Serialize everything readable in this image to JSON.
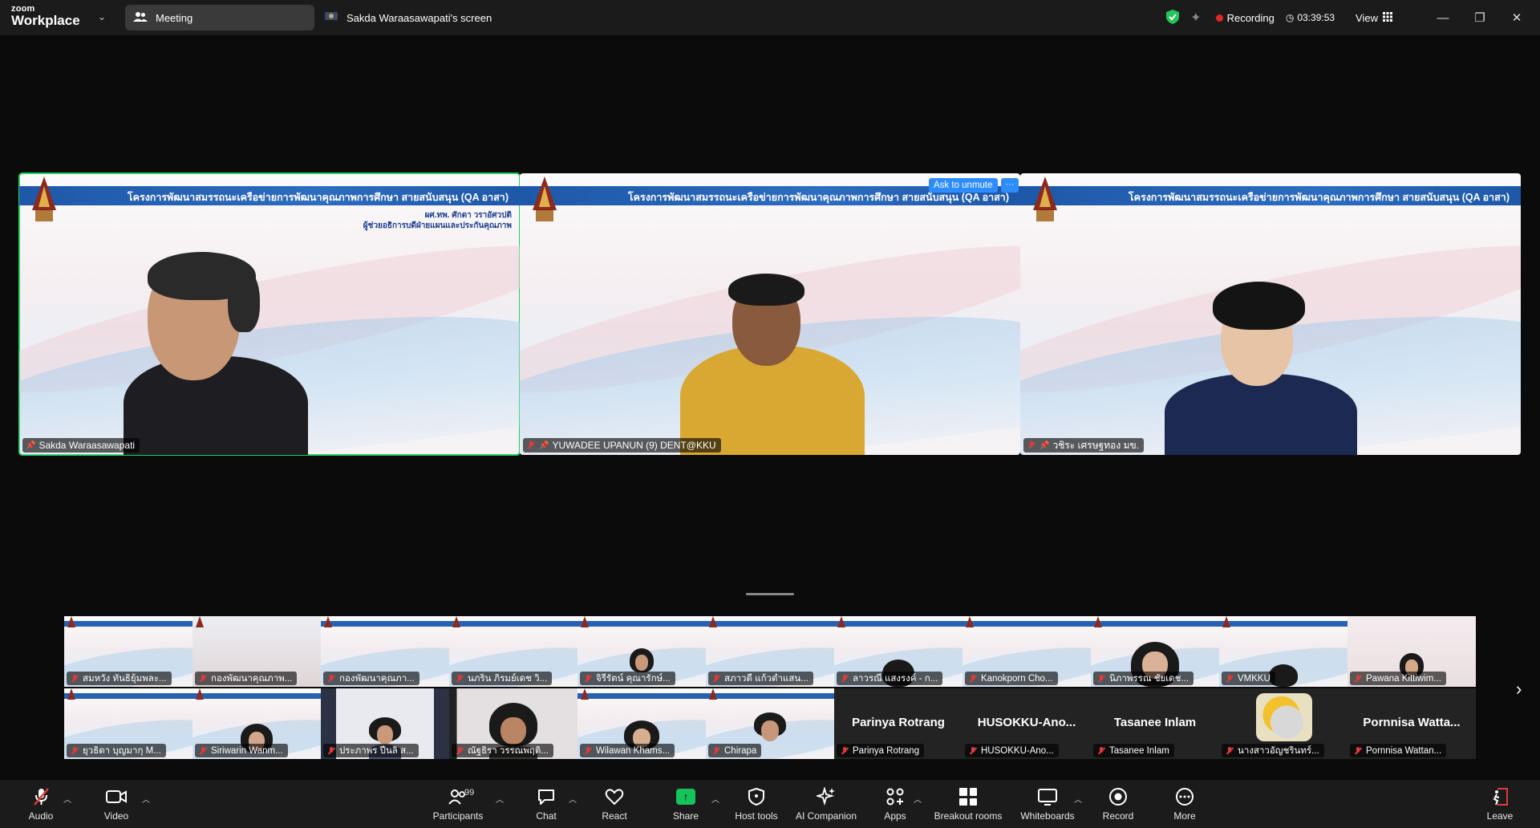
{
  "titlebar": {
    "brand_top": "zoom",
    "brand_bottom": "Workplace",
    "meeting_tab": "Meeting",
    "screen_tab": "Sakda Waraasawapati's screen",
    "recording_label": "Recording",
    "timer": "03:39:53",
    "view_label": "View"
  },
  "slide": {
    "banner_title": "โครงการพัฒนาสมรรถนะเครือข่ายการพัฒนาคุณภาพการศึกษา สายสนับสนุน (QA อาสา)",
    "presenter_name": "ผศ.ทพ. ศักดา วราอัศวปติ",
    "presenter_role": "ผู้ช่วยอธิการบดีฝ่ายแผนและประกันคุณภาพ"
  },
  "main_tiles": [
    {
      "name": "Sakda Waraasawapati"
    },
    {
      "name": "YUWADEE UPANUN (9) DENT@KKU"
    },
    {
      "name": "วชิระ เศรษฐทอง มข."
    }
  ],
  "ask_to_unmute": "Ask to unmute",
  "more_dots": "···",
  "thumbnails_row1": [
    {
      "name": "สมหวัง ทันธิยุ้มพละ..."
    },
    {
      "name": "กองพัฒนาคุณภาพ..."
    },
    {
      "name": "กองพัฒนาคุณภา..."
    },
    {
      "name": "นภริน ภิรมย์เดช วิ..."
    },
    {
      "name": "จิรีรัตน์ คุณารักษ์..."
    },
    {
      "name": "สภาวดี แก้วดำแสน..."
    },
    {
      "name": "ลาวรณี แสงรงค์ - ก..."
    },
    {
      "name": "Kanokporn Cho..."
    },
    {
      "name": "นิภาพรรณ ชัยเดช..."
    },
    {
      "name": "VMKKU"
    },
    {
      "name": "Pawana Kittiwim..."
    }
  ],
  "thumbnails_row2": [
    {
      "name": "ยุวธิดา บุญมากุ M..."
    },
    {
      "name": "Siriwarin Wanm..."
    },
    {
      "name": "ประภาพร ปีนลิ ส..."
    },
    {
      "name": "ณัฐธิรา วรรณพฤติ..."
    },
    {
      "name": "Wilawan Khams..."
    },
    {
      "name": "Chirapa"
    },
    {
      "name": "Parinya Rotrang",
      "big": "Parinya Rotrang"
    },
    {
      "name": "HUSOKKU-Ano...",
      "big": "HUSOKKU-Ano..."
    },
    {
      "name": "Tasanee Inlam",
      "big": "Tasanee Inlam"
    },
    {
      "name": "นางสาวอัญชรินทร์..."
    },
    {
      "name": "Pornnisa Wattan...",
      "big": "Pornnisa  Watta..."
    }
  ],
  "toolbar": {
    "audio": "Audio",
    "video": "Video",
    "participants": "Participants",
    "participants_count": "99",
    "chat": "Chat",
    "react": "React",
    "share": "Share",
    "host_tools": "Host tools",
    "ai_companion": "AI Companion",
    "apps": "Apps",
    "breakout_rooms": "Breakout rooms",
    "whiteboards": "Whiteboards",
    "record": "Record",
    "more": "More",
    "leave": "Leave"
  },
  "colors": {
    "active_speaker": "#23d160",
    "recording": "#e02828",
    "share_green": "#16c35a",
    "banner_blue": "#2961b1",
    "toolbar_bg": "#1b1b1b"
  },
  "icons": [
    "shield-check-icon",
    "sparkle-icon",
    "clock-icon",
    "grid-view-icon",
    "minimize-icon",
    "restore-icon",
    "close-icon",
    "mic-off-icon",
    "video-icon",
    "participants-icon",
    "chat-icon",
    "heart-icon",
    "share-arrow-icon",
    "shield-icon",
    "ai-sparkle-icon",
    "apps-icon",
    "breakout-grid-icon",
    "whiteboard-icon",
    "record-icon",
    "more-dots-icon",
    "leave-icon",
    "chevron-right-icon"
  ]
}
